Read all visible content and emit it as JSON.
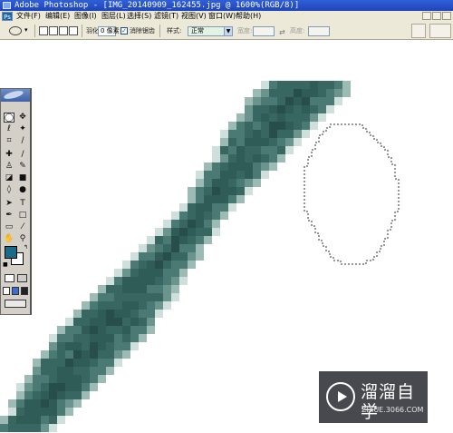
{
  "window": {
    "title": "Adobe Photoshop - [IMG_20140909_162455.jpg @ 1600%(RGB/8)]"
  },
  "menu": {
    "items": [
      "文件(F)",
      "编辑(E)",
      "图像(I)",
      "图层(L)",
      "选择(S)",
      "滤镜(T)",
      "视图(V)",
      "窗口(W)",
      "帮助(H)"
    ]
  },
  "options": {
    "feather_label": "羽化:",
    "feather_value": "0 像素",
    "antialias_label": "消除锯齿",
    "antialias_checked": true,
    "style_label": "样式:",
    "style_value": "正常",
    "width_label": "宽度:",
    "height_label": "高度:",
    "width_value": "",
    "height_value": ""
  },
  "toolbox": {
    "tools": [
      {
        "name": "marquee-tool",
        "glyph": "◯",
        "active": true
      },
      {
        "name": "move-tool",
        "glyph": "✥",
        "active": false
      },
      {
        "name": "lasso-tool",
        "glyph": "ℓ",
        "active": false
      },
      {
        "name": "magic-wand-tool",
        "glyph": "✦",
        "active": false
      },
      {
        "name": "crop-tool",
        "glyph": "⌗",
        "active": false
      },
      {
        "name": "slice-tool",
        "glyph": "∕",
        "active": false
      },
      {
        "name": "healing-brush-tool",
        "glyph": "✚",
        "active": false
      },
      {
        "name": "brush-tool",
        "glyph": "∕",
        "active": false
      },
      {
        "name": "clone-stamp-tool",
        "glyph": "♙",
        "active": false
      },
      {
        "name": "history-brush-tool",
        "glyph": "✎",
        "active": false
      },
      {
        "name": "eraser-tool",
        "glyph": "◪",
        "active": false
      },
      {
        "name": "gradient-tool",
        "glyph": "■",
        "active": false
      },
      {
        "name": "blur-tool",
        "glyph": "◊",
        "active": false
      },
      {
        "name": "dodge-tool",
        "glyph": "●",
        "active": false
      },
      {
        "name": "path-selection-tool",
        "glyph": "➤",
        "active": false
      },
      {
        "name": "type-tool",
        "glyph": "T",
        "active": false
      },
      {
        "name": "pen-tool",
        "glyph": "✒",
        "active": false
      },
      {
        "name": "shape-tool",
        "glyph": "□",
        "active": false
      },
      {
        "name": "notes-tool",
        "glyph": "▭",
        "active": false
      },
      {
        "name": "eyedropper-tool",
        "glyph": "⁄",
        "active": false
      },
      {
        "name": "hand-tool",
        "glyph": "✋",
        "active": false
      },
      {
        "name": "zoom-tool",
        "glyph": "⚲",
        "active": false
      }
    ],
    "foreground_color": "#1a6a88",
    "background_color": "#ffffff"
  },
  "watermark": {
    "title": "溜溜自学",
    "url": "ZIXUE.3066.COM"
  },
  "colors": {
    "accent": "#2f5fd8",
    "panel": "#ece9d8",
    "stroke_dark": "#274e49",
    "stroke_mid": "#4a7a73",
    "stroke_light": "#9cbbb5"
  }
}
